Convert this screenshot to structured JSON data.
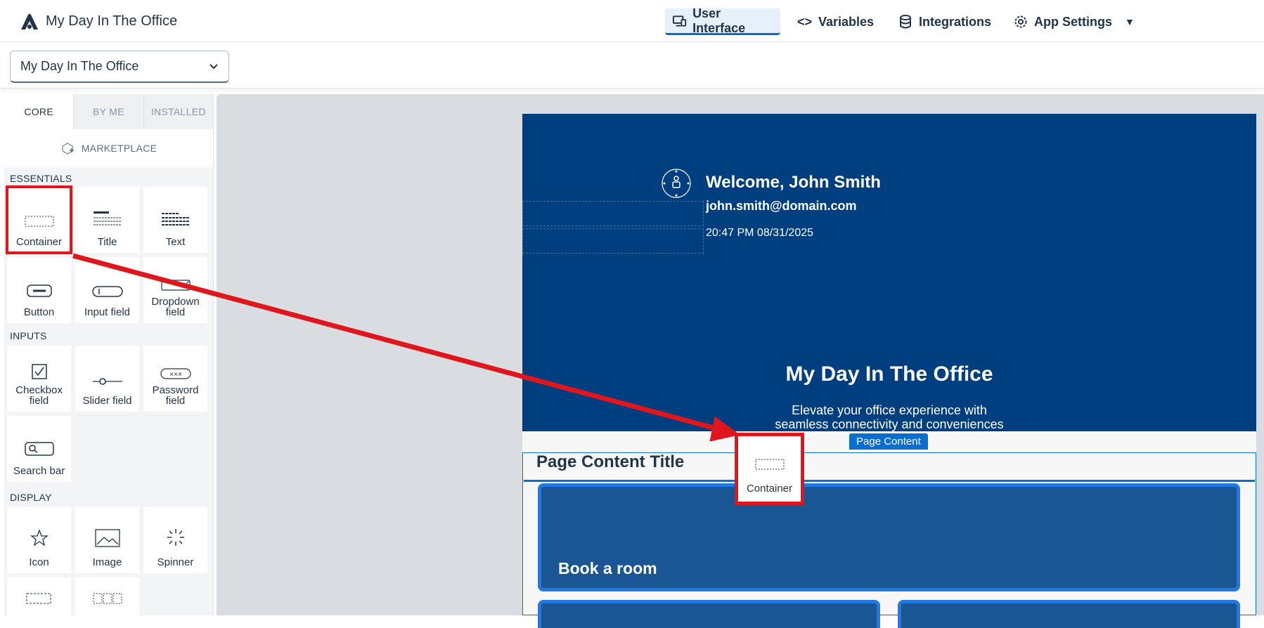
{
  "header": {
    "app_name": "My Day In The Office",
    "nav": [
      {
        "label": "User Interface",
        "icon": "monitor-icon",
        "active": true
      },
      {
        "label": "Variables",
        "icon": "code-icon"
      },
      {
        "label": "Integrations",
        "icon": "database-icon"
      },
      {
        "label": "App Settings",
        "icon": "gear-icon"
      }
    ]
  },
  "page_selector": {
    "value": "My Day In The Office"
  },
  "palette": {
    "tabs": [
      "CORE",
      "BY ME",
      "INSTALLED"
    ],
    "marketplace": "MARKETPLACE",
    "sections": [
      {
        "label": "ESSENTIALS",
        "items": [
          "Container",
          "Title",
          "Text",
          "Button",
          "Input field",
          "Dropdown field"
        ]
      },
      {
        "label": "INPUTS",
        "items": [
          "Checkbox field",
          "Slider field",
          "Password field",
          "Search bar"
        ]
      },
      {
        "label": "DISPLAY",
        "items": [
          "Icon",
          "Image",
          "Spinner"
        ]
      }
    ]
  },
  "preview": {
    "welcome": "Welcome, John Smith",
    "email": "john.smith@domain.com",
    "time": "20:47 PM 08/31/2025",
    "hero_title": "My Day In The Office",
    "hero_subtitle": "Elevate your office experience with seamless connectivity and conveniences",
    "page_content_badge": "Page Content",
    "page_content_title": "Page Content Title",
    "card_label": "Book a room"
  },
  "drag_ghost": {
    "label": "Container"
  },
  "colors": {
    "hero": "#003f7f",
    "accent": "#0a6ed1",
    "highlight": "#e1161c"
  }
}
